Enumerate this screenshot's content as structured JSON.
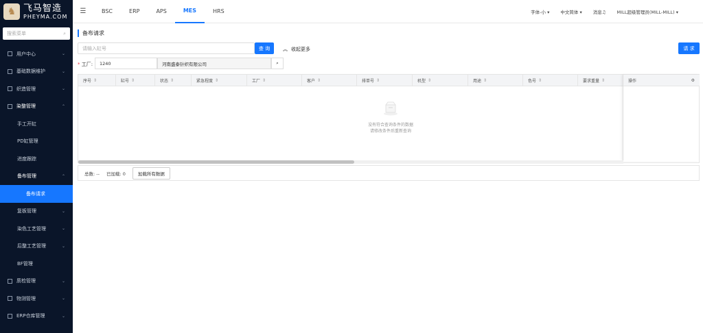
{
  "brand": {
    "name_cn": "飞马智造",
    "name_en": "PHEYMA.COM"
  },
  "sidebar": {
    "search_placeholder": "搜索菜单",
    "items": [
      {
        "label": "用户中心"
      },
      {
        "label": "基础数据维护"
      },
      {
        "label": "织造管理"
      },
      {
        "label": "染整管理"
      },
      {
        "label": "手工开缸"
      },
      {
        "label": "PD缸管理"
      },
      {
        "label": "进度跟踪"
      },
      {
        "label": "备布管理"
      },
      {
        "label": "备布请求"
      },
      {
        "label": "复板管理"
      },
      {
        "label": "染色工艺管理"
      },
      {
        "label": "后整工艺管理"
      },
      {
        "label": "BF管理"
      },
      {
        "label": "质检管理"
      },
      {
        "label": "物测管理"
      },
      {
        "label": "ERP仓库管理"
      }
    ]
  },
  "topbar": {
    "tabs": [
      "BSC",
      "ERP",
      "APS",
      "MES",
      "HRS"
    ],
    "active_tab": "MES",
    "font_size": "字体-小",
    "language": "中文简体",
    "messages": "消息",
    "user": "MILL超级管理员(MILL-MILL)"
  },
  "page": {
    "title": "备布请求",
    "search_placeholder": "请输入缸号",
    "search_button": "查 询",
    "collapse_label": "收起更多",
    "request_button": "请 求",
    "factory_label": "工厂:",
    "factory_code": "1240",
    "factory_name": "河南盛泰针织有限公司"
  },
  "table": {
    "columns": [
      "序号",
      "缸号",
      "状态",
      "紧急程度",
      "工厂",
      "客户",
      "排单号",
      "机型",
      "用途",
      "色号",
      "要求重量"
    ],
    "op_header": "操作",
    "empty_line1": "没有符合查询条件的数据",
    "empty_line2": "请修改条件后重新查询"
  },
  "footer": {
    "total": "总数: --",
    "loaded": "已加载: 0",
    "load_all": "加载所有数据"
  },
  "colors": {
    "accent": "#1677ff",
    "sidebar_bg": "#0a1529"
  }
}
